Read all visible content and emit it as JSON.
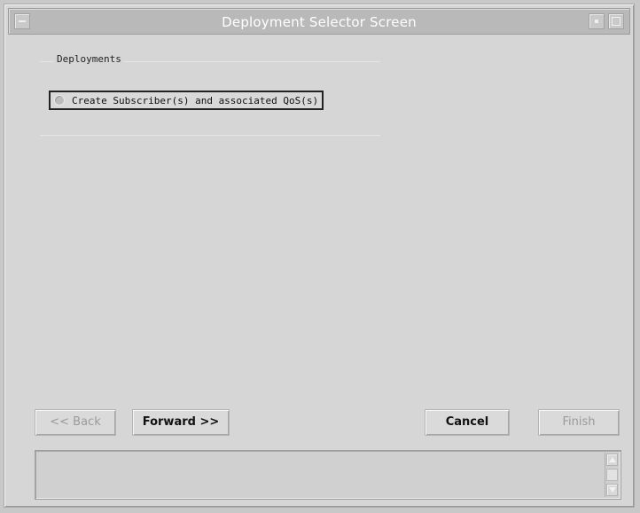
{
  "window": {
    "title": "Deployment Selector Screen"
  },
  "deployments": {
    "group_label": "Deployments",
    "option_label": "Create Subscriber(s) and associated QoS(s)",
    "option_selected": false
  },
  "buttons": {
    "back": "<< Back",
    "forward": "Forward >>",
    "cancel": "Cancel",
    "finish": "Finish"
  },
  "status": {
    "message": ""
  },
  "icons": {
    "window_menu": "window-menu-icon",
    "minimize": "minimize-icon",
    "maximize": "maximize-icon",
    "scroll_up": "scroll-up-arrow-icon",
    "scroll_down": "scroll-down-arrow-icon",
    "radio": "radio-button-icon"
  },
  "colors": {
    "titlebar": "#b9b9b9",
    "window_bg": "#d6d6d6",
    "title_text": "#ffffff"
  }
}
